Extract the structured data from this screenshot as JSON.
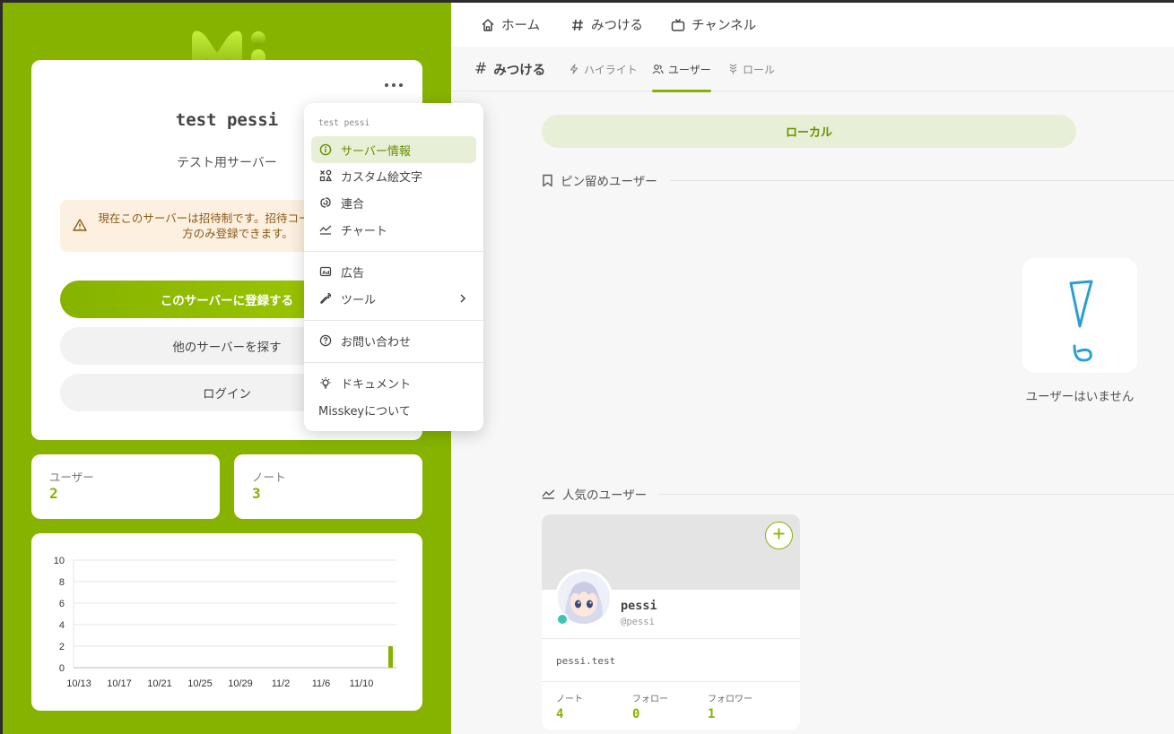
{
  "colors": {
    "accent": "#86b300",
    "accent_light": "#e7efd6",
    "warning_bg": "#fdf0e0",
    "online": "#3cc4b4"
  },
  "server": {
    "name": "test pessi",
    "description": "テスト用サーバー",
    "invite_notice": "現在このサーバーは招待制です。招待コードをお持ちの方のみ登録できます。",
    "signup_label": "このサーバーに登録する",
    "explore_label": "他のサーバーを探す",
    "login_label": "ログイン"
  },
  "stats": {
    "users_label": "ユーザー",
    "users_value": "2",
    "notes_label": "ノート",
    "notes_value": "3"
  },
  "chart_data": {
    "type": "bar",
    "categories": [
      "10/13",
      "10/17",
      "10/21",
      "10/25",
      "10/29",
      "11/2",
      "11/6",
      "11/10"
    ],
    "x_tick_labels": [
      "10/13",
      "10/17",
      "10/21",
      "10/25",
      "10/29",
      "11/2",
      "11/6",
      "11/10"
    ],
    "y_ticks": [
      "0",
      "2",
      "4",
      "6",
      "8",
      "10"
    ],
    "ylim": [
      0,
      10
    ],
    "bars": [
      {
        "x": "11/11",
        "value": 2
      }
    ],
    "grid": true
  },
  "nav": {
    "home": "ホーム",
    "explore": "みつける",
    "channels": "チャンネル"
  },
  "page": {
    "title": "みつける",
    "tabs": [
      {
        "label": "ハイライト",
        "icon": "bolt-icon"
      },
      {
        "label": "ユーザー",
        "icon": "users-icon"
      },
      {
        "label": "ロール",
        "icon": "badge-icon"
      }
    ],
    "local_toggle": "ローカル",
    "pinned_heading": "ピン留めユーザー",
    "empty_text": "ユーザーはいません",
    "popular_heading": "人気のユーザー"
  },
  "user_card": {
    "name": "pessi",
    "handle": "@pessi",
    "bio": "pessi.test",
    "notes_label": "ノート",
    "notes_value": "4",
    "following_label": "フォロー",
    "following_value": "0",
    "followers_label": "フォロワー",
    "followers_value": "1"
  },
  "menu": {
    "header": "test pessi",
    "items": [
      {
        "label": "サーバー情報",
        "icon": "info-icon"
      },
      {
        "label": "カスタム絵文字",
        "icon": "emoji-icon"
      },
      {
        "label": "連合",
        "icon": "federation-icon"
      },
      {
        "label": "チャート",
        "icon": "chart-icon"
      },
      {
        "label": "広告",
        "icon": "ad-icon"
      },
      {
        "label": "ツール",
        "icon": "tool-icon"
      },
      {
        "label": "お問い合わせ",
        "icon": "help-icon"
      },
      {
        "label": "ドキュメント",
        "icon": "bulb-icon"
      },
      {
        "label": "Misskeyについて"
      }
    ]
  }
}
